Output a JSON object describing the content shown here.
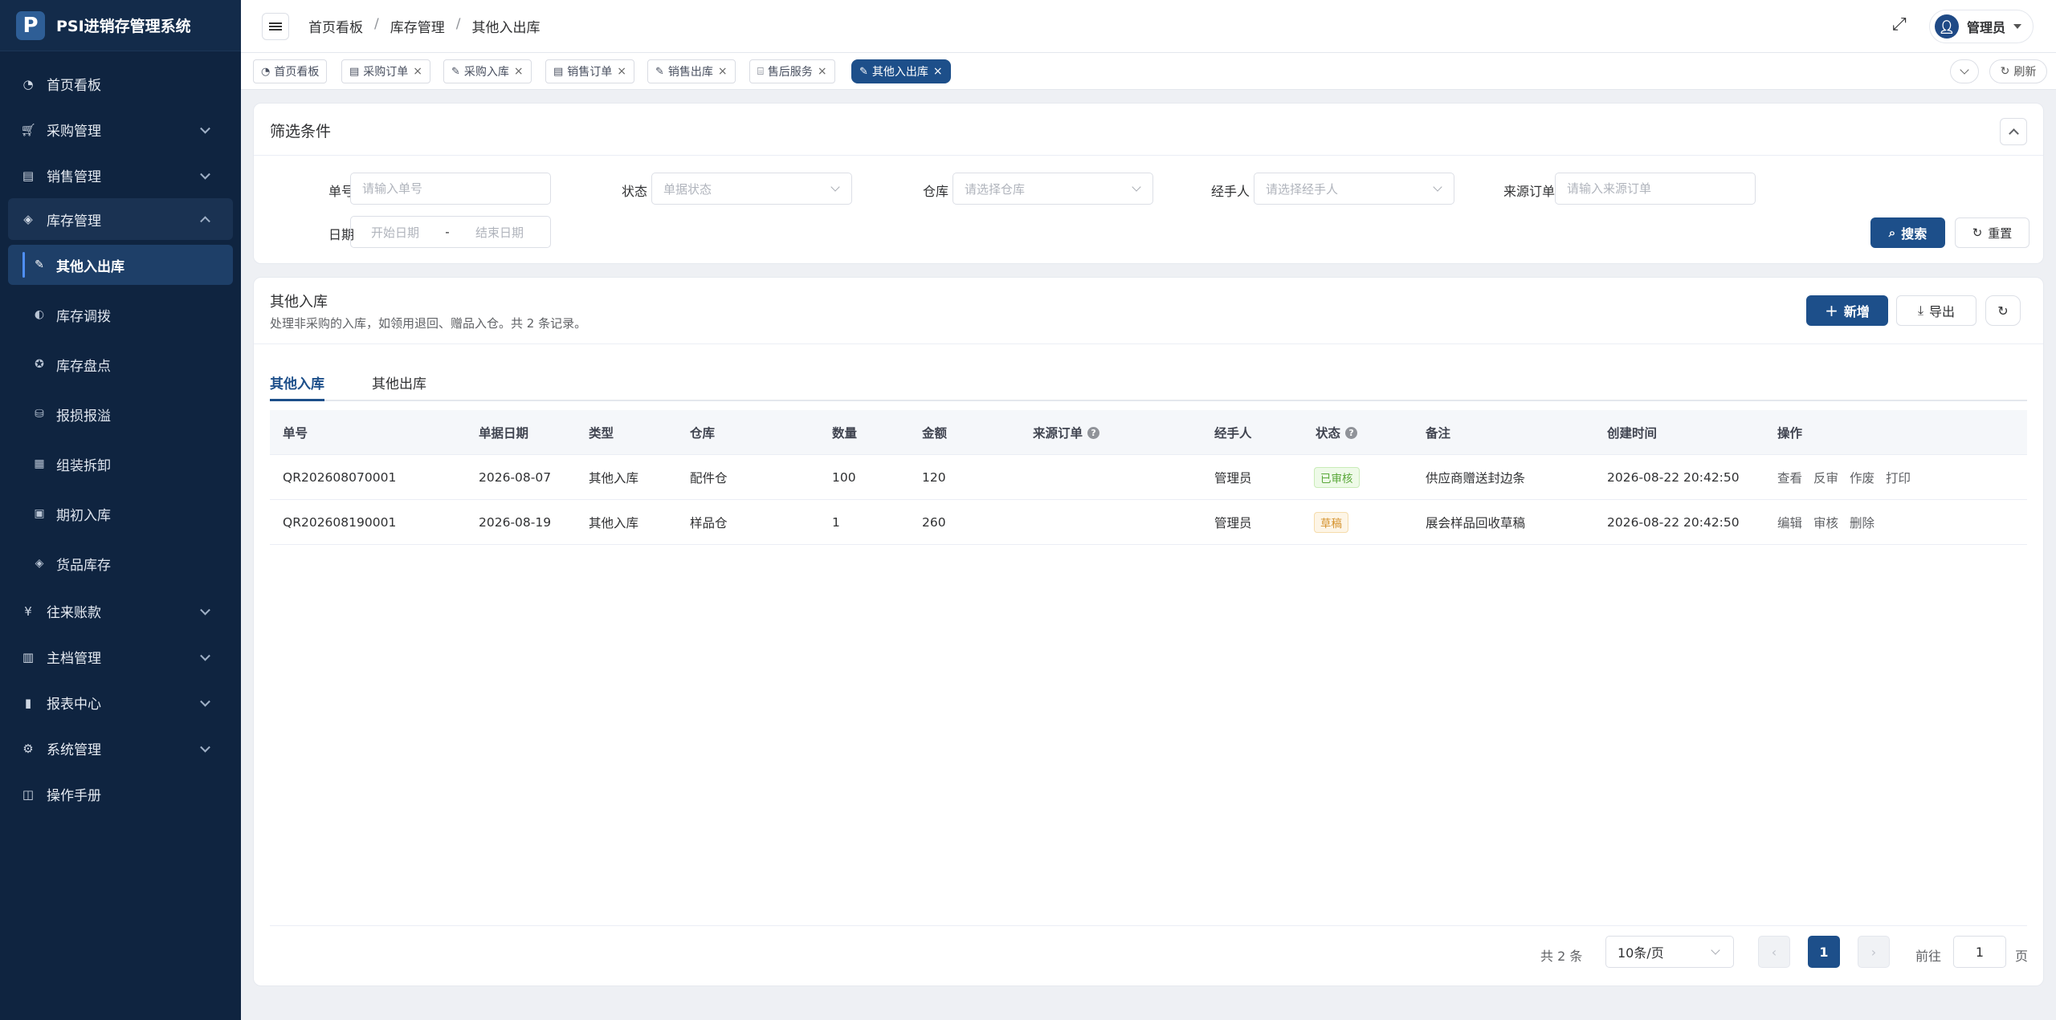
{
  "app": {
    "title": "PSI进销存管理系统",
    "logo_letter": "P"
  },
  "sidebar": {
    "items": [
      {
        "label": "首页看板",
        "icon": "dashboard-icon"
      },
      {
        "label": "采购管理",
        "icon": "cart-icon"
      },
      {
        "label": "销售管理",
        "icon": "sales-icon"
      },
      {
        "label": "库存管理",
        "icon": "layers-icon"
      },
      {
        "label": "往来账款",
        "icon": "yen-icon"
      },
      {
        "label": "主档管理",
        "icon": "archive-icon"
      },
      {
        "label": "报表中心",
        "icon": "bar-chart-icon"
      },
      {
        "label": "系统管理",
        "icon": "gear-icon"
      },
      {
        "label": "操作手册",
        "icon": "book-icon"
      }
    ],
    "sub_items": [
      {
        "label": "其他入出库",
        "icon": "edit-icon"
      },
      {
        "label": "库存调拨",
        "icon": "toggle-icon"
      },
      {
        "label": "库存盘点",
        "icon": "life-ring-icon"
      },
      {
        "label": "报损报溢",
        "icon": "chart-icon"
      },
      {
        "label": "组装拆卸",
        "icon": "grid-icon"
      },
      {
        "label": "期初入库",
        "icon": "calendar-icon"
      },
      {
        "label": "货品库存",
        "icon": "layers-icon"
      }
    ]
  },
  "header": {
    "breadcrumb": [
      "首页看板",
      "库存管理",
      "其他入出库"
    ],
    "breadcrumb_sep": "/",
    "user": "管理员"
  },
  "tags": {
    "items": [
      {
        "label": "首页看板",
        "closable": false
      },
      {
        "label": "采购订单",
        "closable": true
      },
      {
        "label": "采购入库",
        "closable": true
      },
      {
        "label": "销售订单",
        "closable": true
      },
      {
        "label": "销售出库",
        "closable": true
      },
      {
        "label": "售后服务",
        "closable": true
      },
      {
        "label": "其他入出库",
        "closable": true,
        "active": true
      }
    ],
    "refresh_label": "刷新"
  },
  "filter": {
    "title": "筛选条件",
    "order_no": {
      "label": "单号",
      "placeholder": "请输入单号"
    },
    "status": {
      "label": "状态",
      "placeholder": "单据状态"
    },
    "warehouse": {
      "label": "仓库",
      "placeholder": "请选择仓库"
    },
    "handler": {
      "label": "经手人",
      "placeholder": "请选择经手人"
    },
    "source_order": {
      "label": "来源订单",
      "placeholder": "请输入来源订单"
    },
    "date": {
      "label": "日期",
      "start_placeholder": "开始日期",
      "end_placeholder": "结束日期",
      "sep": "-"
    },
    "search_label": "搜索",
    "reset_label": "重置"
  },
  "list": {
    "title": "其他入库",
    "description": "处理非采购的入库，如领用退回、赠品入仓。共 2 条记录。",
    "add_label": "新增",
    "export_label": "导出",
    "tabs": [
      "其他入库",
      "其他出库"
    ],
    "columns": [
      "单号",
      "单据日期",
      "类型",
      "仓库",
      "数量",
      "金额",
      "来源订单",
      "经手人",
      "状态",
      "备注",
      "创建时间",
      "操作"
    ],
    "rows": [
      {
        "no": "QR202608070001",
        "date": "2026-08-07",
        "type": "其他入库",
        "warehouse": "配件仓",
        "qty": "100",
        "amount": "120",
        "source": "",
        "handler": "管理员",
        "status": "已审核",
        "status_kind": "ok",
        "remark": "供应商赠送封边条",
        "created": "2026-08-22 20:42:50",
        "actions": [
          "查看",
          "反审",
          "作废",
          "打印"
        ]
      },
      {
        "no": "QR202608190001",
        "date": "2026-08-19",
        "type": "其他入库",
        "warehouse": "样品仓",
        "qty": "1",
        "amount": "260",
        "source": "",
        "handler": "管理员",
        "status": "草稿",
        "status_kind": "draft",
        "remark": "展会样品回收草稿",
        "created": "2026-08-22 20:42:50",
        "actions": [
          "编辑",
          "审核",
          "删除"
        ]
      }
    ]
  },
  "pagination": {
    "total": "共 2 条",
    "page_size": "10条/页",
    "current": "1",
    "goto_label": "前往",
    "goto_value": "1",
    "page_unit": "页"
  },
  "colors": {
    "sidebar_bg": "#0f2440",
    "primary": "#1d4f8a",
    "ok": "#5aa83a",
    "draft": "#d4912a"
  }
}
